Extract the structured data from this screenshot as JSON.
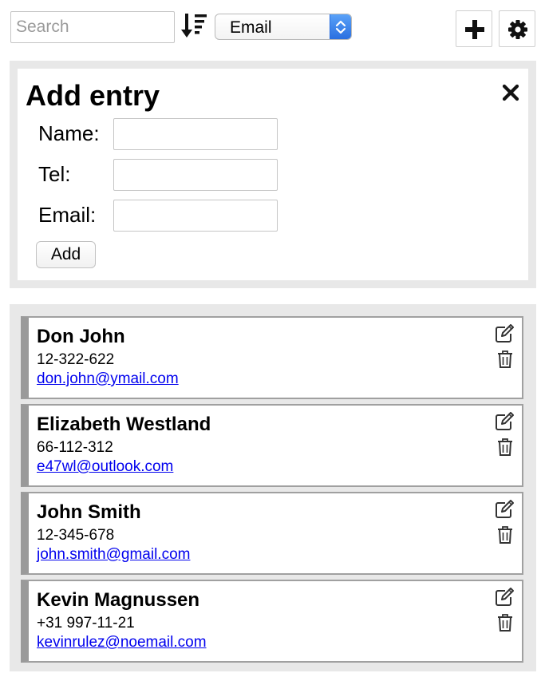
{
  "toolbar": {
    "search_placeholder": "Search",
    "sort_icon": "sort-descending-icon",
    "sort_field": "Email",
    "add_icon": "plus-icon",
    "settings_icon": "gear-icon",
    "select_accent": "#3d86ee"
  },
  "add_entry": {
    "title": "Add entry",
    "close_icon": "close-icon",
    "fields": [
      {
        "label": "Name:",
        "value": ""
      },
      {
        "label": "Tel:",
        "value": ""
      },
      {
        "label": "Email:",
        "value": ""
      }
    ],
    "submit_label": "Add"
  },
  "contacts": [
    {
      "name": "Don John",
      "tel": "12-322-622",
      "email": "don.john@ymail.com"
    },
    {
      "name": "Elizabeth Westland",
      "tel": "66-112-312",
      "email": "e47wl@outlook.com"
    },
    {
      "name": "John Smith",
      "tel": "12-345-678",
      "email": "john.smith@gmail.com"
    },
    {
      "name": "Kevin Magnussen",
      "tel": "+31 997-11-21",
      "email": "kevinrulez@noemail.com"
    }
  ],
  "contact_actions": {
    "edit_icon": "edit-icon",
    "delete_icon": "trash-icon"
  },
  "colors": {
    "panel_background": "#e8e8e8",
    "card_accent": "#9a9a9a",
    "link": "#0000ee"
  }
}
